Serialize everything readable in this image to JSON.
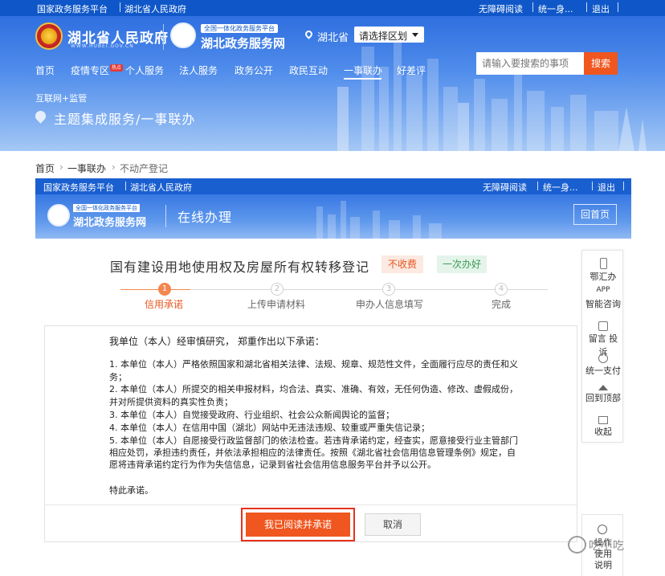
{
  "topbar": {
    "left": [
      "国家政务服务平台",
      "湖北省人民政府"
    ],
    "right": [
      "无障碍阅读",
      "统一身...",
      "退出"
    ]
  },
  "header": {
    "gov_name": "湖北省人民政府",
    "gov_domain": "WWW.HUBEI.GOV.CN",
    "portal_tagline": "全国一体化政务服务平台",
    "portal_name": "湖北政务服务网",
    "location": "湖北省",
    "region_select": "请选择区划",
    "search_placeholder": "请输入要搜索的事项",
    "search_button": "搜索",
    "nav": [
      "首页",
      "疫情专区",
      "个人服务",
      "法人服务",
      "政务公开",
      "政民互动",
      "一事联办",
      "好差评"
    ],
    "nav_badge": "热点",
    "active_nav": "一事联办",
    "sub_nav": "互联网+监管",
    "section_title": "主题集成服务/一事联办"
  },
  "breadcrumb": [
    "首页",
    "一事联办",
    "不动产登记"
  ],
  "inner": {
    "topbar_left": [
      "国家政务服务平台",
      "湖北省人民政府"
    ],
    "topbar_right": [
      "无障碍阅读",
      "统一身...",
      "退出"
    ],
    "portal_tagline": "全国一体化政务服务平台",
    "portal_name": "湖北政务服务网",
    "title": "在线办理",
    "home_button": "回首页"
  },
  "form": {
    "title": "国有建设用地使用权及房屋所有权转移登记",
    "tags": [
      "不收费",
      "一次办好"
    ],
    "steps": [
      {
        "num": "1",
        "label": "信用承诺",
        "active": true
      },
      {
        "num": "2",
        "label": "上传申请材料",
        "active": false
      },
      {
        "num": "3",
        "label": "申办人信息填写",
        "active": false
      },
      {
        "num": "4",
        "label": "完成",
        "active": false
      }
    ],
    "promise_heading": "我单位（本人）经审慎研究， 郑重作出以下承诺：",
    "promise_lines": [
      "1. 本单位（本人）严格依照国家和湖北省相关法律、法规、规章、规范性文件，全面履行应尽的责任和义",
      "务；",
      "2. 本单位（本人）所提交的相关申报材料，均合法、真实、准确、有效，无任何伪造、修改、虚假成份，",
      "并对所提供资料的真实性负责；",
      "3. 本单位（本人）自觉接受政府、行业组织、社会公众新闻舆论的监督；",
      "4. 本单位（本人）在信用中国（湖北）网站中无违法违规、较重或严重失信记录；",
      "5. 本单位（本人）自愿接受行政监督部门的依法检查。若违背承诺约定，经查实，愿意接受行业主管部门",
      "相应处罚，承担违约责任，并依法承担相应的法律责任。按照《湖北省社会信用信息管理条例》规定，自",
      "愿将违背承诺约定行为作为失信信息，记录到省社会信用信息服务平台并予以公开。"
    ],
    "promise_closing": "特此承诺。",
    "agree_button": "我已阅读并承诺",
    "cancel_button": "取消"
  },
  "sidebar": {
    "items": [
      "鄂汇办",
      "APP",
      "智能咨询",
      "留言 投",
      "诉",
      "统一支付",
      "回到顶部",
      "收起"
    ],
    "help": "操作使用说明"
  },
  "watermark": "吃小吃"
}
